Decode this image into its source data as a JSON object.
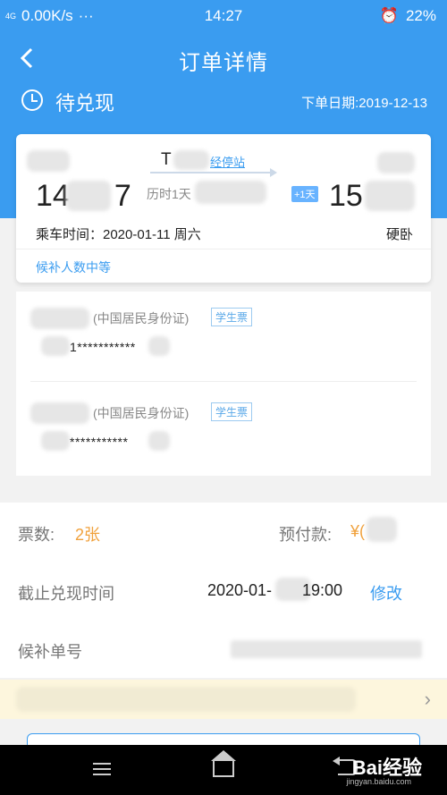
{
  "status_bar": {
    "network": "4G",
    "speed": "0.00K/s",
    "dots": "···",
    "time": "14:27",
    "battery": "22%"
  },
  "nav": {
    "title": "订单详情",
    "back_icon": "chevron-left-icon"
  },
  "order_status": {
    "label": "待兑现",
    "date_label": "下单日期:2019-12-13"
  },
  "trip": {
    "train_prefix": "T",
    "stops_link": "经停站",
    "departure_time_visible": "14",
    "departure_time_suffix": "7",
    "duration": "历时1天",
    "plus_days": "+1天",
    "arrival_time_visible": "15",
    "boarding": "乘车时间：2020-01-11 周六",
    "seat_type": "硬卧",
    "waiting_status": "候补人数中等"
  },
  "passengers": [
    {
      "id_type": "(中国居民身份证)",
      "ticket_tag": "学生票",
      "id_number": "1***********"
    },
    {
      "id_type": "(中国居民身份证)",
      "ticket_tag": "学生票",
      "id_number": "***********"
    }
  ],
  "summary": {
    "ticket_count_label": "票数:",
    "ticket_count": "2张",
    "prepay_label": "预付款:",
    "prepay_value": "¥(",
    "deadline_label": "截止兑现时间",
    "deadline_value_a": "2020-01-",
    "deadline_value_b": "19:00",
    "edit_label": "修改",
    "order_no_label": "候补单号"
  },
  "banner": {
    "chevron": "›"
  },
  "footer": {
    "watermark": "Bai经验",
    "watermark_sub": "jingyan.baidu.com"
  },
  "colors": {
    "primary": "#3a9cf0",
    "accent_orange": "#f0a13c",
    "banner": "#fdf6dd"
  }
}
